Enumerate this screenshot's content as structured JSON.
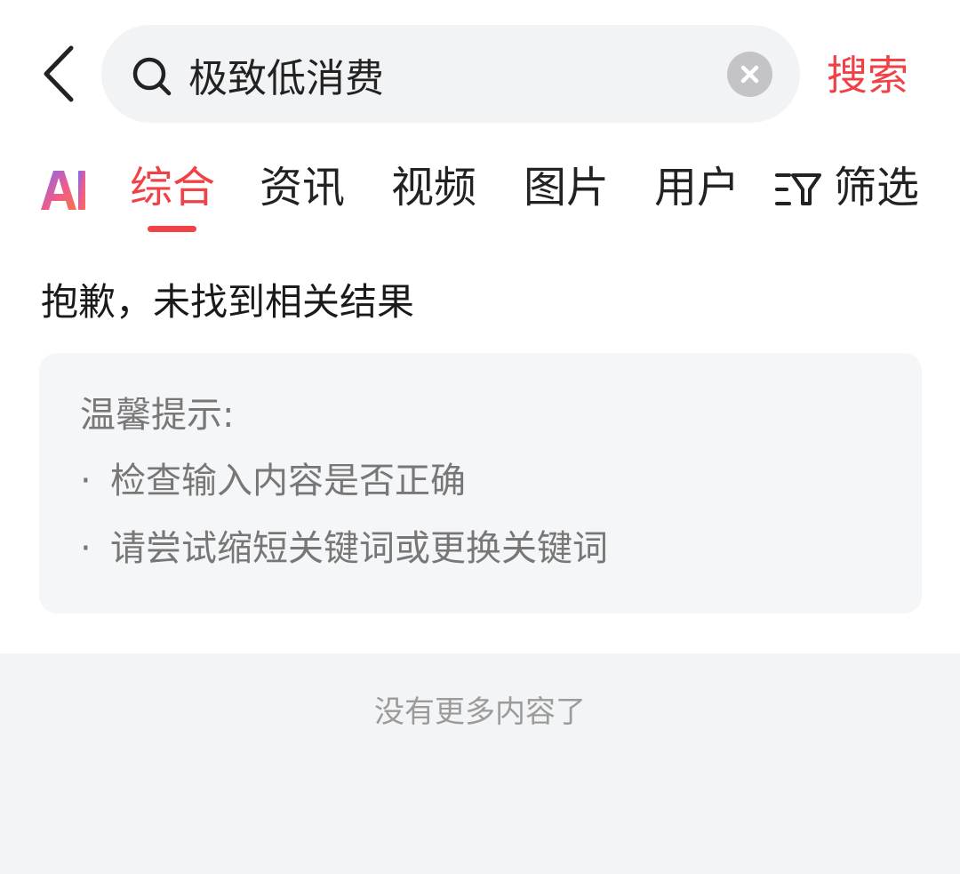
{
  "search": {
    "query": "极致低消费",
    "submit_label": "搜索",
    "icons": {
      "back": "chevron-left-icon",
      "search": "search-icon",
      "clear": "close-circle-icon"
    }
  },
  "tabs": {
    "items": [
      {
        "label": "综合",
        "active": true
      },
      {
        "label": "资讯",
        "active": false
      },
      {
        "label": "视频",
        "active": false
      },
      {
        "label": "图片",
        "active": false
      },
      {
        "label": "用户",
        "active": false
      }
    ],
    "filter_label": "筛选",
    "icons": {
      "ai": "ai-logo-icon",
      "filter": "filter-icon"
    }
  },
  "result": {
    "empty_title": "抱歉，未找到相关结果",
    "tips": {
      "heading": "温馨提示:",
      "items": [
        {
          "bullet": "·",
          "text": "检查输入内容是否正确"
        },
        {
          "bullet": "·",
          "text": "请尝试缩短关键词或更换关键词"
        }
      ]
    }
  },
  "footer": {
    "end_text": "没有更多内容了"
  },
  "colors": {
    "accent": "#f04246",
    "search_bg": "#f2f3f5",
    "card_bg": "#f5f6f8",
    "footer_bg": "#f3f4f6",
    "hint_text": "#777777",
    "muted_text": "#9b9b9b"
  }
}
